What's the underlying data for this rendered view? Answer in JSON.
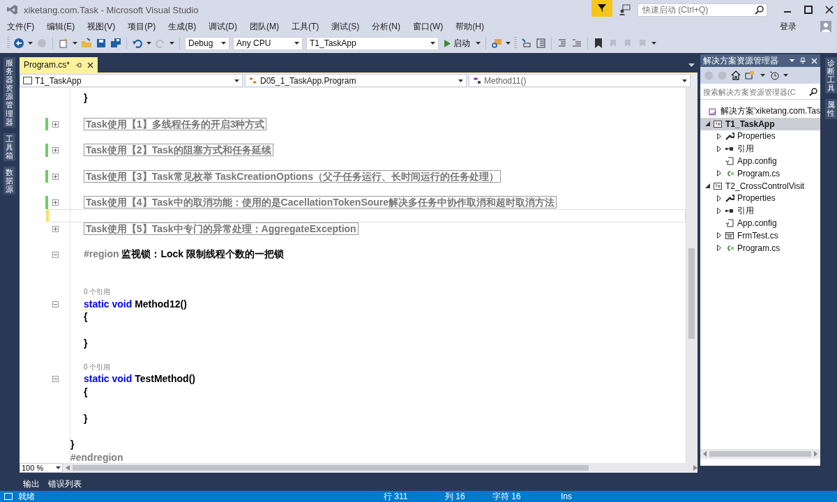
{
  "window": {
    "title": "xiketang.com.Task - Microsoft Visual Studio",
    "quick_launch": {
      "placeholder": "快速启动 (Ctrl+Q)"
    }
  },
  "menu": {
    "items": [
      "文件(F)",
      "编辑(E)",
      "视图(V)",
      "项目(P)",
      "生成(B)",
      "调试(D)",
      "团队(M)",
      "工具(T)",
      "测试(S)",
      "分析(N)",
      "窗口(W)",
      "帮助(H)"
    ],
    "login": "登录"
  },
  "toolbar": {
    "configuration": "Debug",
    "platform": "Any CPU",
    "startup_project": "T1_TaskApp",
    "start": "启动"
  },
  "left_tabs": [
    "服务器资源管理器",
    "工具箱",
    "数据源"
  ],
  "editor": {
    "tabs": [
      {
        "label": "Program.cs*",
        "selected": true
      }
    ],
    "nav": {
      "project": "T1_TaskApp",
      "type": "D05_1_TaskApp.Program",
      "member": "Method11()"
    },
    "lines": [
      {
        "kind": "brace",
        "text": "}"
      },
      {
        "kind": "blank"
      },
      {
        "kind": "collapsed",
        "text": "Task使用【1】多线程任务的开启3种方式",
        "color": "#6ccf5f"
      },
      {
        "kind": "blank"
      },
      {
        "kind": "collapsed",
        "text": "Task使用【2】Task的阻塞方式和任务延续",
        "color": "#6ccf5f"
      },
      {
        "kind": "blank"
      },
      {
        "kind": "collapsed",
        "text": "Task使用【3】Task常见枚举 TaskCreationOptions（父子任务运行、长时间运行的任务处理）",
        "color": "#6ccf5f"
      },
      {
        "kind": "blank"
      },
      {
        "kind": "collapsed",
        "text": "Task使用【4】Task中的取消功能：使用的是CacellationTokenSoure解决多任务中协作取消和超时取消方法",
        "color": "#6ccf5f"
      },
      {
        "kind": "cursor-line",
        "color": "#eee26b"
      },
      {
        "kind": "collapsed",
        "text": "Task使用【5】Task中专门的异常处理：AggregateException"
      },
      {
        "kind": "blank"
      },
      {
        "kind": "region",
        "keyword": "#region",
        "text": "监视锁：Lock  限制线程个数的一把锁"
      },
      {
        "kind": "blank"
      },
      {
        "kind": "blank"
      },
      {
        "kind": "codelens",
        "text": "0 个引用"
      },
      {
        "kind": "method",
        "keyword": "static void",
        "text": "Method12()"
      },
      {
        "kind": "brace",
        "text": "{"
      },
      {
        "kind": "blank"
      },
      {
        "kind": "brace",
        "text": "}"
      },
      {
        "kind": "blank"
      },
      {
        "kind": "codelens",
        "text": "0 个引用"
      },
      {
        "kind": "method",
        "keyword": "static void",
        "text": "TestMethod()"
      },
      {
        "kind": "brace",
        "text": "{"
      },
      {
        "kind": "blank"
      },
      {
        "kind": "brace",
        "text": "}"
      },
      {
        "kind": "blank"
      },
      {
        "kind": "class-brace",
        "text": "}"
      },
      {
        "kind": "endregion",
        "text": "#endregion"
      }
    ],
    "zoom": "100 %"
  },
  "solution_explorer": {
    "title": "解决方案资源管理器",
    "search": {
      "placeholder": "搜索解决方案资源管理器(C"
    },
    "tree": [
      {
        "kind": "solution",
        "label": "解决方案'xiketang.com.Tas",
        "selected": false,
        "children": [
          {
            "kind": "csproj",
            "label": "T1_TaskApp",
            "expanded": true,
            "selected": true,
            "children": [
              {
                "kind": "properties",
                "label": "Properties",
                "expanded": false,
                "selected": false
              },
              {
                "kind": "references",
                "label": "引用",
                "expanded": false,
                "selected": false
              },
              {
                "kind": "config",
                "label": "App.config",
                "selected": false
              },
              {
                "kind": "csfile",
                "label": "Program.cs",
                "expanded": false,
                "selected": false
              }
            ]
          },
          {
            "kind": "csproj",
            "label": "T2_CrossControlVisit",
            "expanded": true,
            "selected": false,
            "children": [
              {
                "kind": "properties",
                "label": "Properties",
                "expanded": false,
                "selected": false
              },
              {
                "kind": "references",
                "label": "引用",
                "expanded": false,
                "selected": false
              },
              {
                "kind": "config",
                "label": "App.config",
                "selected": false
              },
              {
                "kind": "form",
                "label": "FrmTest.cs",
                "expanded": false,
                "selected": false
              },
              {
                "kind": "csfile",
                "label": "Program.cs",
                "expanded": false,
                "selected": false
              }
            ]
          }
        ]
      }
    ]
  },
  "right_tabs": [
    "诊断工具",
    "属性"
  ],
  "bottom_tabs": [
    {
      "label": "输出",
      "selected": false
    },
    {
      "label": "错误列表",
      "selected": false
    }
  ],
  "status_bar": {
    "message": "就绪",
    "line": "行 311",
    "column": "列 16",
    "char": "字符 16",
    "mode": "Ins"
  }
}
